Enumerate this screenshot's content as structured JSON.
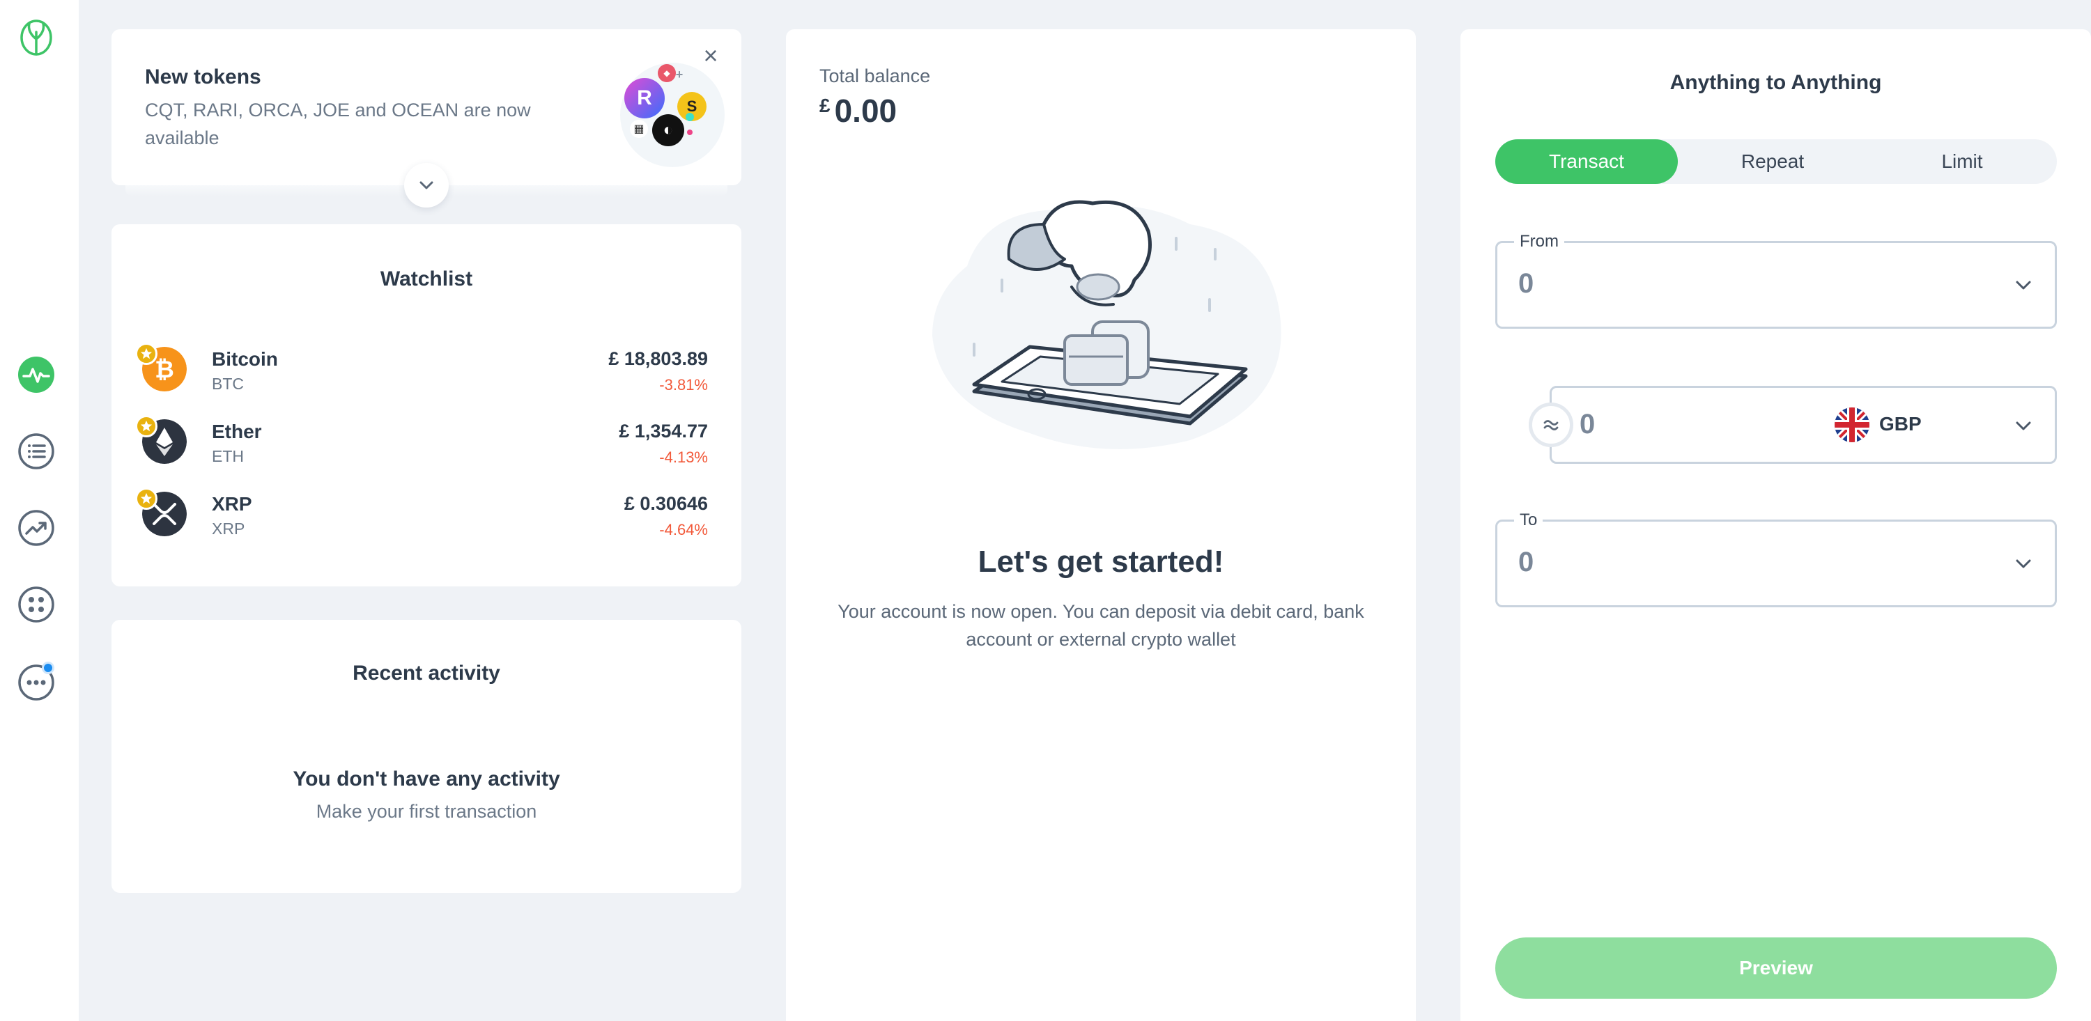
{
  "colors": {
    "accent": "#3ec467",
    "negative": "#f2593a",
    "background": "#eff2f6",
    "preview_disabled": "#8ede9e"
  },
  "sidebar": {
    "items": [
      {
        "icon": "logo-icon"
      },
      {
        "icon": "activity-icon",
        "active": true
      },
      {
        "icon": "list-icon"
      },
      {
        "icon": "trending-icon"
      },
      {
        "icon": "apps-icon"
      },
      {
        "icon": "more-icon",
        "has_notification": true
      }
    ]
  },
  "new_tokens": {
    "title": "New tokens",
    "description": "CQT, RARI, ORCA, JOE and OCEAN are now available",
    "close_symbol": "×"
  },
  "watchlist": {
    "title": "Watchlist",
    "items": [
      {
        "name": "Bitcoin",
        "symbol": "BTC",
        "price": "£ 18,803.89",
        "change": "-3.81%",
        "color": "#f7931a"
      },
      {
        "name": "Ether",
        "symbol": "ETH",
        "price": "£ 1,354.77",
        "change": "-4.13%",
        "color": "#2d3440"
      },
      {
        "name": "XRP",
        "symbol": "XRP",
        "price": "£ 0.30646",
        "change": "-4.64%",
        "color": "#2d3440"
      }
    ]
  },
  "recent_activity": {
    "title": "Recent activity",
    "empty_title": "You don't have any activity",
    "empty_subtitle": "Make your first transaction"
  },
  "balance": {
    "label": "Total balance",
    "currency_symbol": "£",
    "value": "0.00",
    "start_title": "Let's get started!",
    "start_description": "Your account is now open. You can deposit via debit card, bank account or external crypto wallet"
  },
  "transact": {
    "title": "Anything to Anything",
    "tabs": [
      {
        "label": "Transact",
        "active": true
      },
      {
        "label": "Repeat",
        "active": false
      },
      {
        "label": "Limit",
        "active": false
      }
    ],
    "from": {
      "label": "From",
      "value": "0"
    },
    "amount": {
      "value": "0",
      "currency": "GBP"
    },
    "to": {
      "label": "To",
      "value": "0"
    },
    "preview_label": "Preview"
  }
}
